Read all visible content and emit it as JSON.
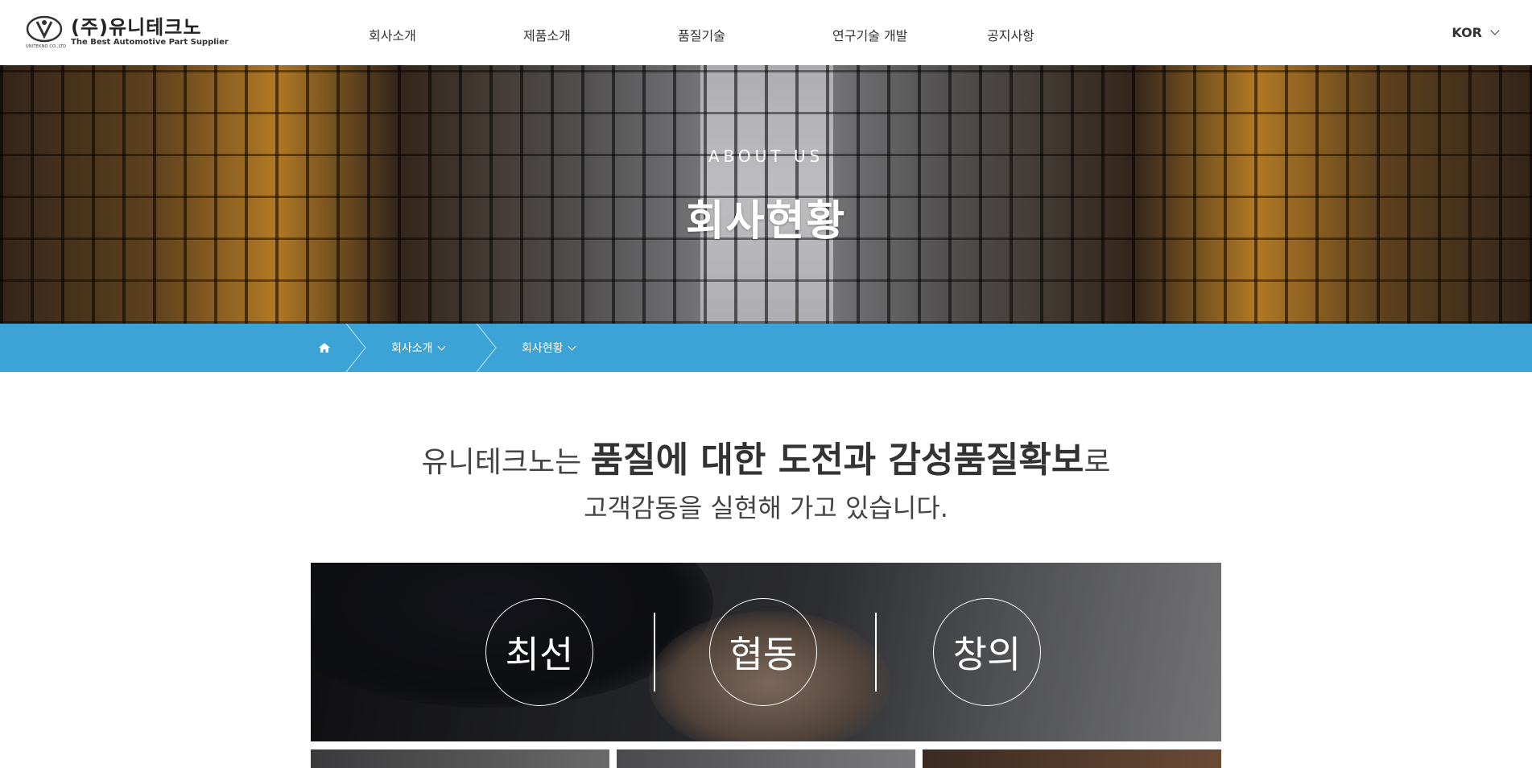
{
  "header": {
    "logo_title": "(주)유니테크노",
    "logo_sub": "The Best Automotive Part Supplier",
    "logo_caption": "UNITEKNO CO.,LTD",
    "nav": [
      "회사소개",
      "제품소개",
      "품질기술",
      "연구기술 개발",
      "공지사항"
    ],
    "lang": "KOR"
  },
  "hero": {
    "kicker": "ABOUT US",
    "title": "회사현황"
  },
  "breadcrumb": {
    "items": [
      "회사소개",
      "회사현황"
    ]
  },
  "intro": {
    "pre": "유니테크노는 ",
    "emph": "품질에 대한 도전과 감성품질확보",
    "post": "로",
    "line2": "고객감동을 실현해 가고 있습니다."
  },
  "values": [
    "최선",
    "협동",
    "창의"
  ],
  "colors": {
    "accent": "#3ba3d6",
    "text": "#333333"
  }
}
